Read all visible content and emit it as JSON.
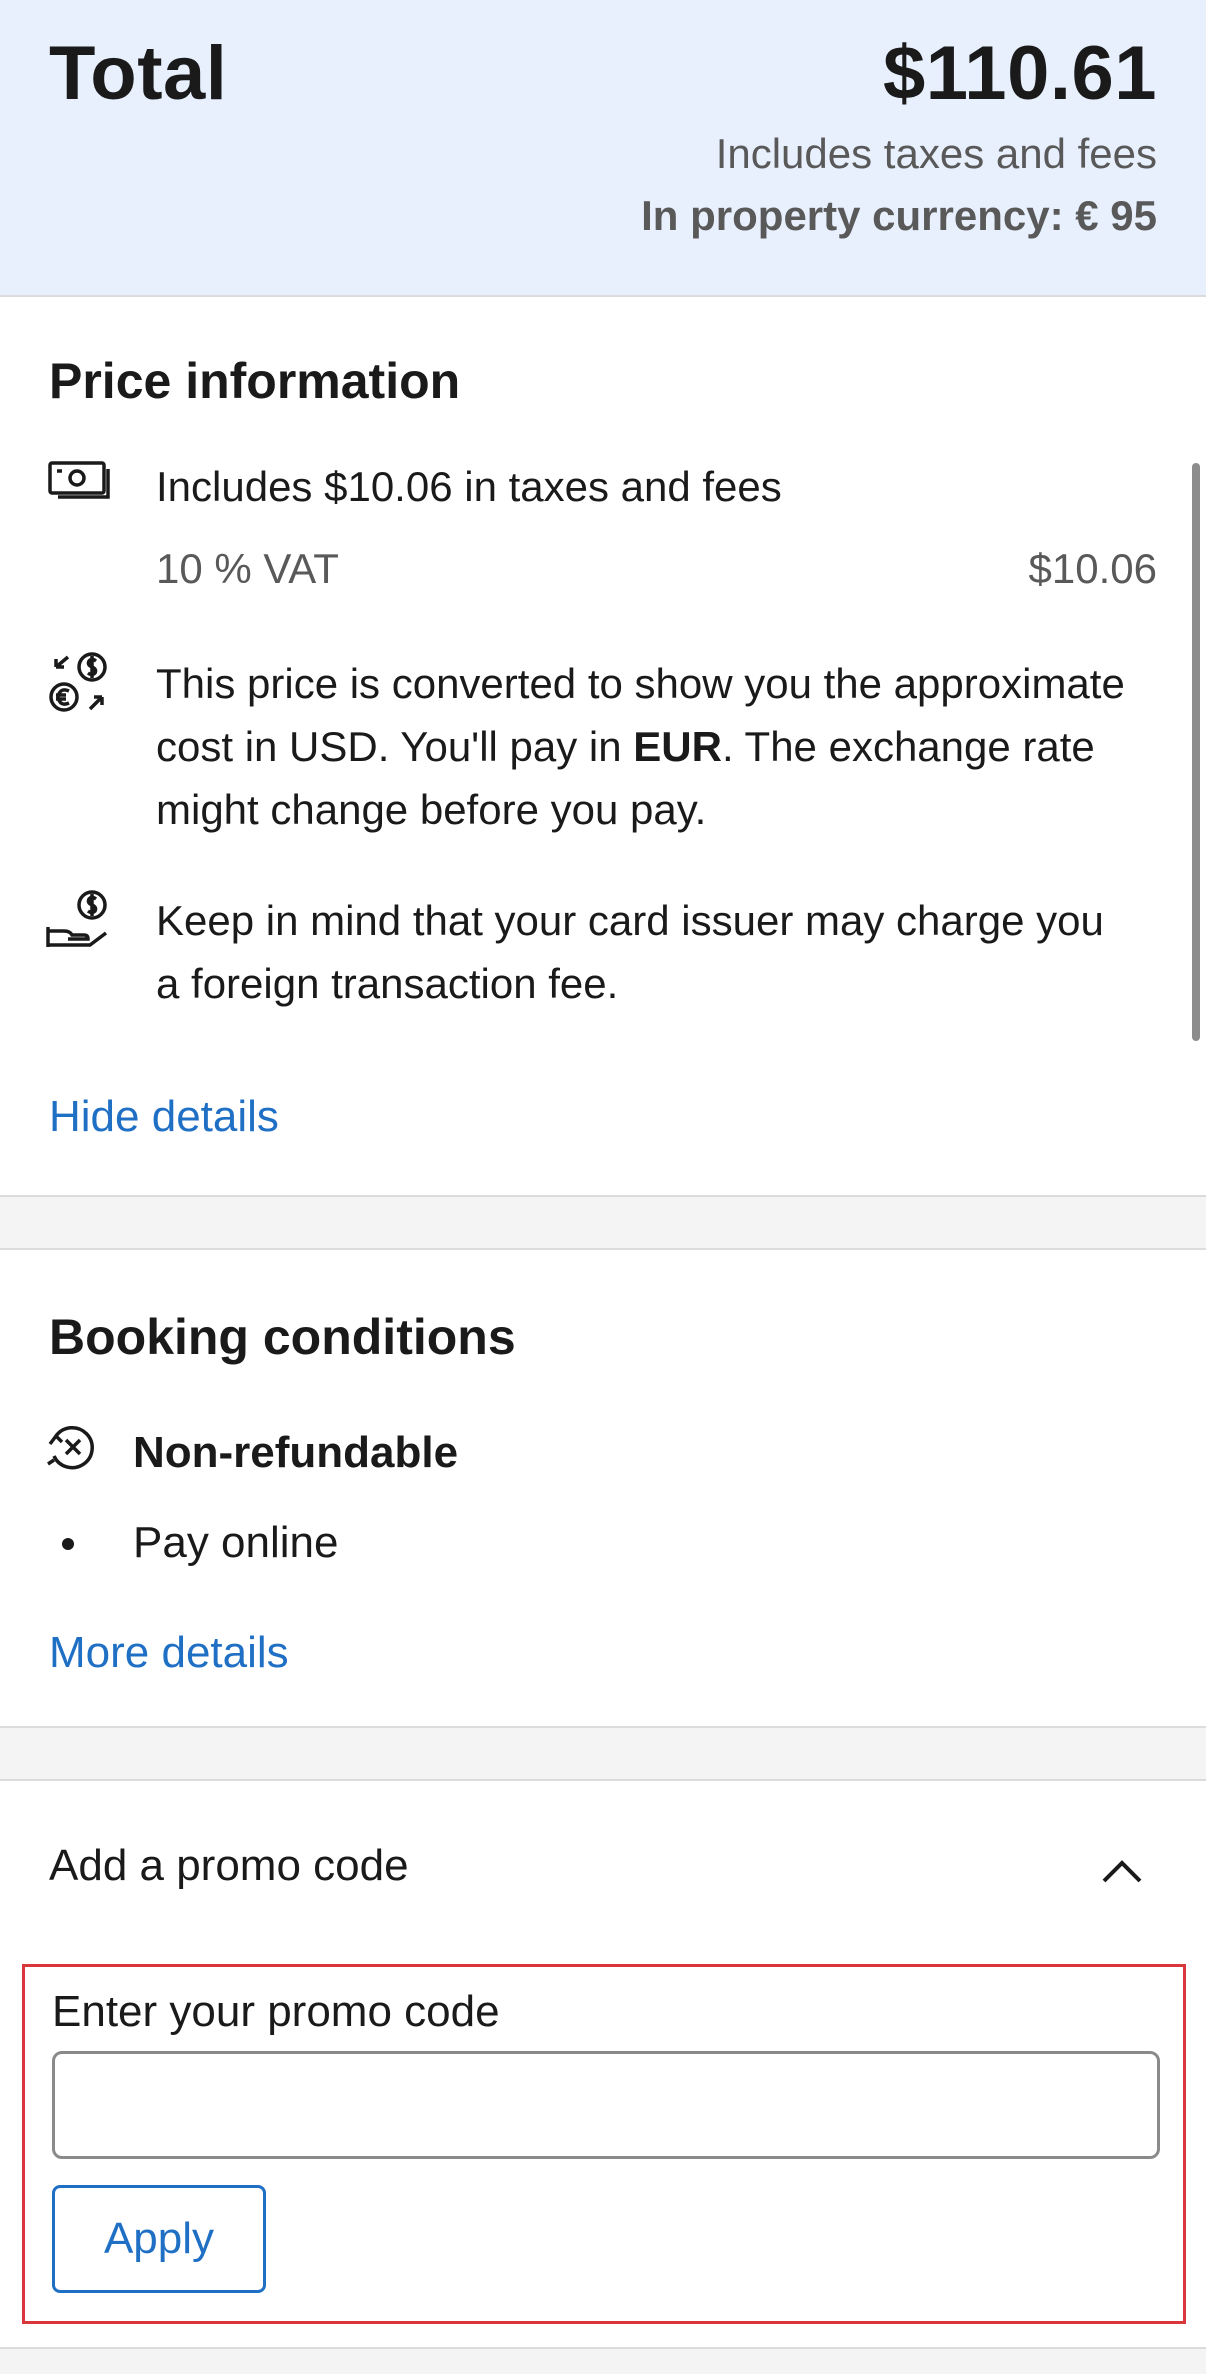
{
  "total": {
    "label": "Total",
    "amount": "$110.61",
    "includes": "Includes taxes and fees",
    "property_currency": "In property currency: € 95"
  },
  "price_info": {
    "title": "Price information",
    "taxes_line": "Includes $10.06 in taxes and fees",
    "vat_label": "10 % VAT",
    "vat_amount": "$10.06",
    "conversion_before": "This price is converted to show you the approximate cost in USD. You'll pay in ",
    "conversion_currency": "EUR",
    "conversion_after": ". The exchange rate might change before you pay.",
    "card_fee_note": "Keep in mind that your card issuer may charge you a foreign transaction fee.",
    "hide_details": "Hide details",
    "icons": [
      "cash-icon",
      "currency-exchange-icon",
      "hand-dollar-icon"
    ]
  },
  "booking": {
    "title": "Booking conditions",
    "refund_policy": "Non-refundable",
    "payment": "Pay online",
    "more_details": "More details",
    "icons": [
      "non-refundable-icon"
    ]
  },
  "promo": {
    "toggle_label": "Add a promo code",
    "field_label": "Enter your promo code",
    "input_value": "",
    "input_placeholder": "",
    "apply_label": "Apply"
  },
  "colors": {
    "header_bg": "#e8f0fe",
    "link": "#1f6fc5",
    "highlight_border": "#d9363e",
    "muted_text": "#595959"
  }
}
